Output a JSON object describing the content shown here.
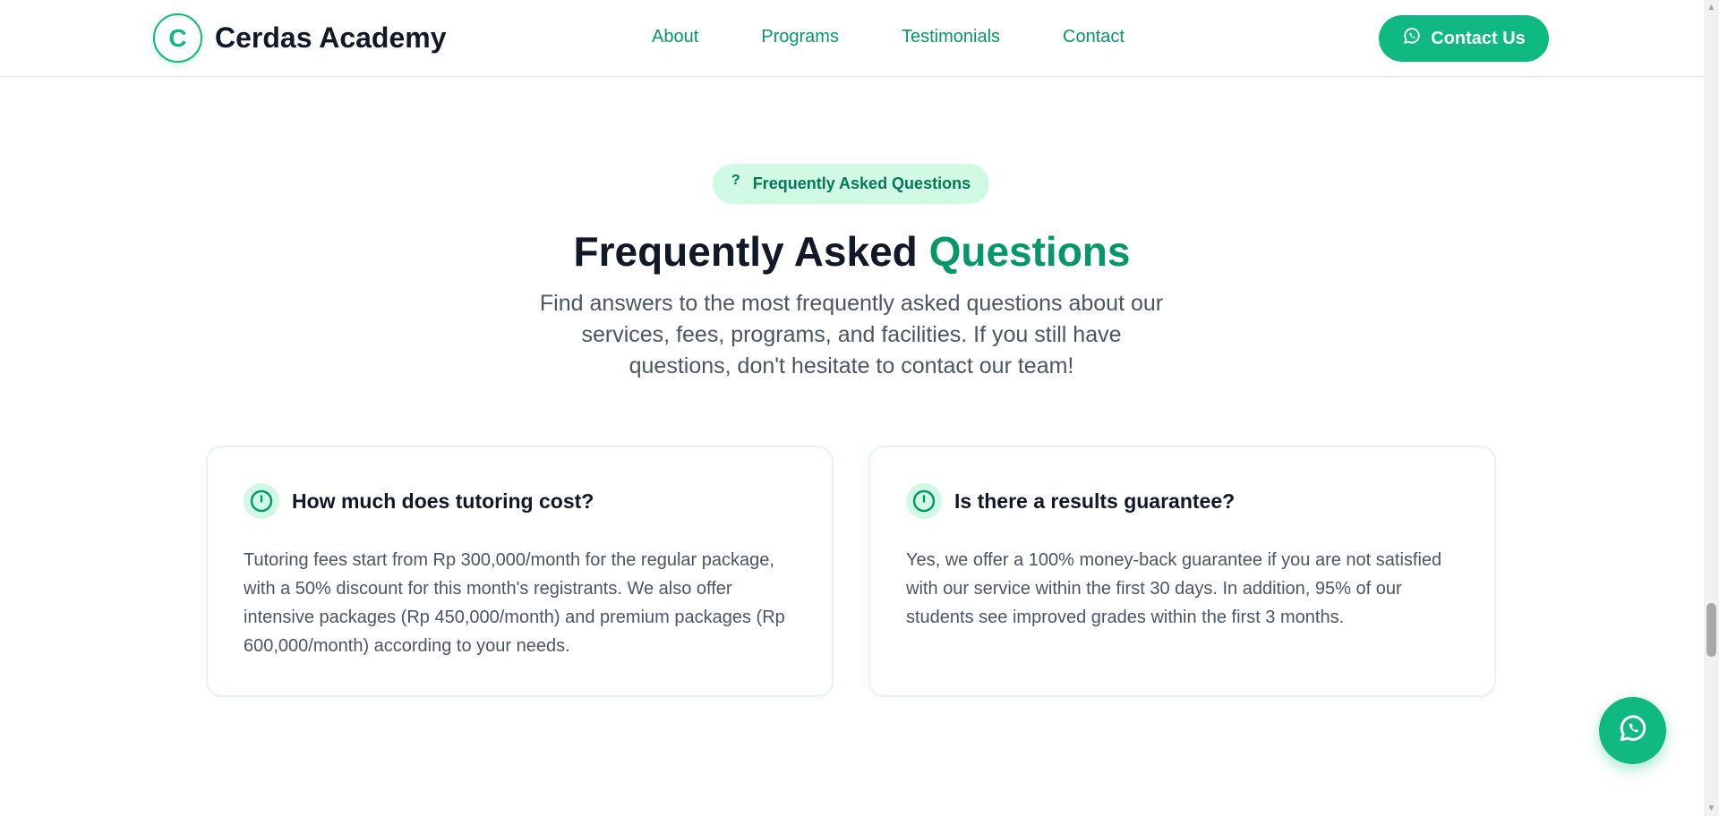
{
  "header": {
    "brand_initial": "C",
    "brand_name": "Cerdas Academy",
    "nav": [
      "About",
      "Programs",
      "Testimonials",
      "Contact"
    ],
    "cta_label": "Contact Us",
    "cta_icon": "whatsapp-icon"
  },
  "faq": {
    "pill_icon": "?",
    "pill_label": "Frequently Asked Questions",
    "title_main": "Frequently Asked ",
    "title_accent": "Questions",
    "subtitle": "Find answers to the most frequently asked questions about our services, fees, programs, and facilities. If you still have questions, don't hesitate to contact our team!",
    "items": [
      {
        "question": "How much does tutoring cost?",
        "answer": "Tutoring fees start from Rp 300,000/month for the regular package, with a 50% discount for this month's registrants. We also offer intensive packages (Rp 450,000/month) and premium packages (Rp 600,000/month) according to your needs."
      },
      {
        "question": "Is there a results guarantee?",
        "answer": "Yes, we offer a 100% money-back guarantee if you are not satisfied with our service within the first 30 days. In addition, 95% of our students see improved grades within the first 3 months."
      }
    ]
  },
  "colors": {
    "accent": "#10b981",
    "accent_dark": "#059669",
    "pill_bg": "#d1fae5"
  },
  "scroll_position": 0.76
}
